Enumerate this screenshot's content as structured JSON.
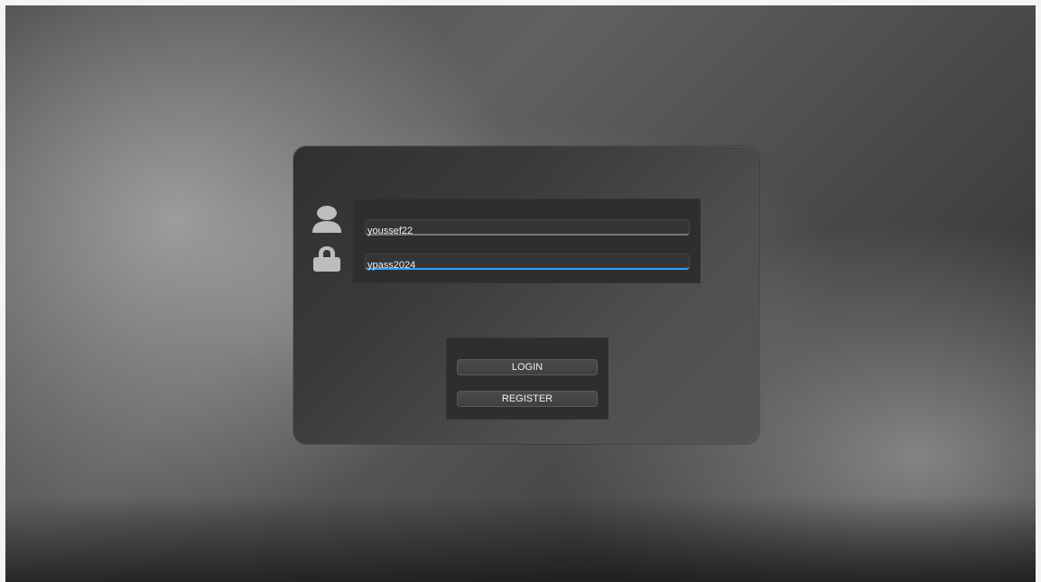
{
  "login": {
    "username_value": "youssef22",
    "password_value": "ypass2024"
  },
  "buttons": {
    "login_label": "LOGIN",
    "register_label": "REGISTER"
  },
  "icons": {
    "user": "user-icon",
    "lock": "lock-icon"
  },
  "colors": {
    "accent_blue": "#3b9df0",
    "panel": "#2e2e2e",
    "card": "#3f3f3f"
  }
}
